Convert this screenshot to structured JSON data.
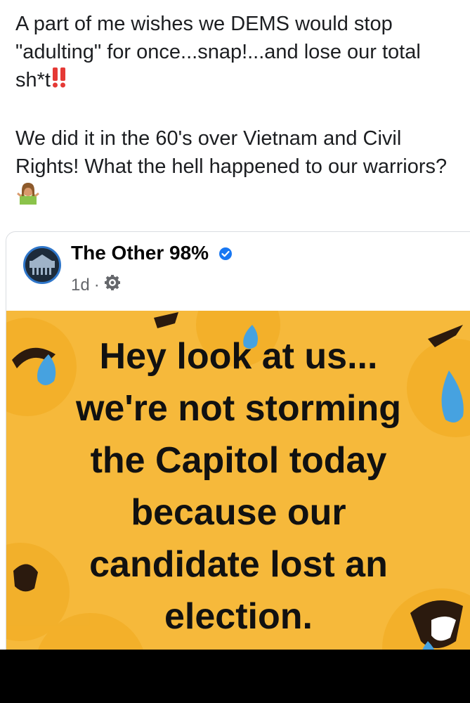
{
  "post": {
    "paragraph_1": "A part of me wishes we DEMS would stop \"adulting\" for once...snap!...and lose our total sh*t",
    "paragraph_1_emoji": "double-exclamation-icon",
    "paragraph_2": "We did it in the 60's over Vietnam and Civil Rights! What the hell happened to our warriors?",
    "paragraph_2_emoji": "person-shrugging-icon"
  },
  "shared_post": {
    "page_name": "The Other 98%",
    "verified_icon": "verified-badge-icon",
    "time": "1d",
    "separator": "·",
    "privacy_icon": "gear-icon",
    "meme_lines": [
      "Hey look at us...",
      "we're not storming",
      "the Capitol today",
      "because our",
      "candidate lost an",
      "election."
    ],
    "meme_background_color": "#f6b93b"
  }
}
